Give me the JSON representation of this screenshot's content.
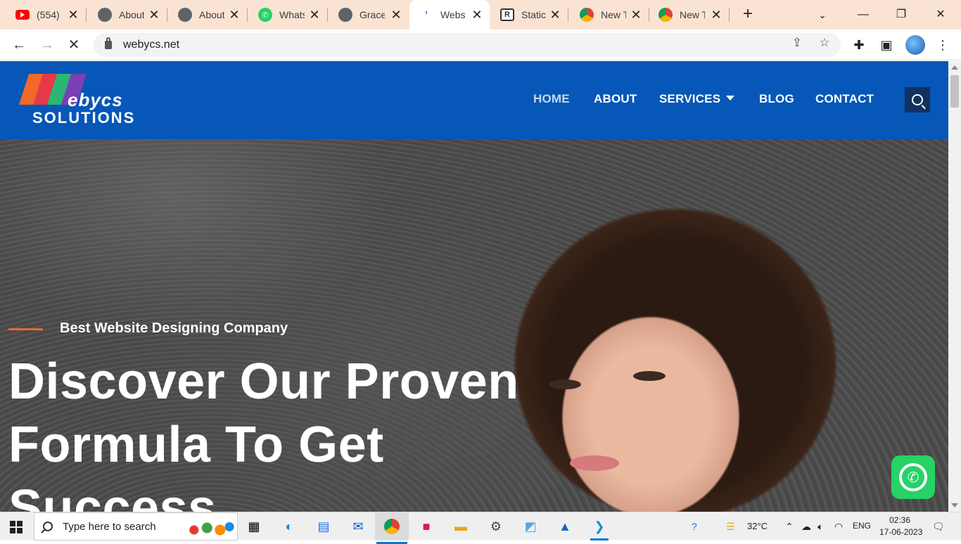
{
  "browser": {
    "tabs": [
      {
        "title": "(554) ‧",
        "favicon": "youtube-icon"
      },
      {
        "title": "About",
        "favicon": "globe-icon"
      },
      {
        "title": "About",
        "favicon": "globe-icon"
      },
      {
        "title": "Whats",
        "favicon": "whatsapp-icon"
      },
      {
        "title": "Grace",
        "favicon": "globe-icon"
      },
      {
        "title": "Websi",
        "favicon": "webycs-icon",
        "active": true
      },
      {
        "title": "Static",
        "favicon": "r-icon"
      },
      {
        "title": "New T",
        "favicon": "chrome-icon"
      },
      {
        "title": "New T",
        "favicon": "chrome-icon"
      }
    ],
    "new_tab_symbol": "+",
    "url": "webycs.net",
    "controls": {
      "minimize": "—",
      "restore": "❐",
      "close": "✕"
    }
  },
  "site": {
    "logo": {
      "word1": "ebycs",
      "word2": "SOLUTIONS"
    },
    "nav": {
      "home": "HOME",
      "about": "ABOUT",
      "services": "SERVICES",
      "blog": "BLOG",
      "contact": "CONTACT"
    },
    "hero": {
      "eyebrow": "Best Website Designing Company",
      "headline": "Discover Our Proven Formula To Get Success"
    },
    "colors": {
      "header": "#0657b7",
      "accent": "#e8692e",
      "search_button": "#14305f",
      "whatsapp": "#25d366"
    }
  },
  "taskbar": {
    "search_placeholder": "Type here to search",
    "weather": "32°C",
    "language": "ENG",
    "time": "02:36",
    "date": "17-06-2023"
  }
}
